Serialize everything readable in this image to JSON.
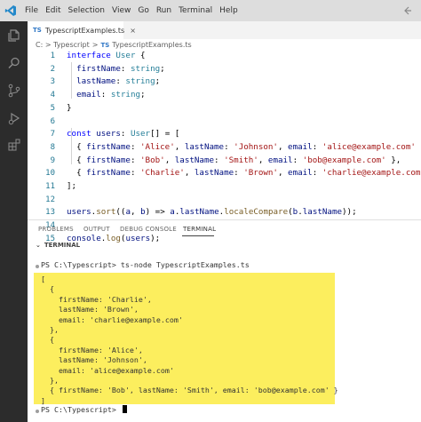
{
  "menu": [
    "File",
    "Edit",
    "Selection",
    "View",
    "Go",
    "Run",
    "Terminal",
    "Help"
  ],
  "editor": {
    "tab_badge": "TS",
    "tab_label": "TypescriptExamples.ts",
    "tab_close": "×",
    "breadcrumb": {
      "folder": "C: > Typescript",
      "sep": ">",
      "badge": "TS",
      "file": "TypescriptExamples.ts"
    },
    "line_numbers": [
      "1",
      "2",
      "3",
      "4",
      "5",
      "6",
      "7",
      "8",
      "9",
      "10",
      "11",
      "12",
      "13",
      "14",
      "15"
    ],
    "lines": [
      [
        {
          "t": "interface ",
          "c": "kw"
        },
        {
          "t": "User",
          "c": "ty"
        },
        {
          "t": " {",
          "c": "pl"
        }
      ],
      [
        {
          "t": "  firstName",
          "c": "vr"
        },
        {
          "t": ": ",
          "c": "pl"
        },
        {
          "t": "string",
          "c": "ty"
        },
        {
          "t": ";",
          "c": "pl"
        }
      ],
      [
        {
          "t": "  lastName",
          "c": "vr"
        },
        {
          "t": ": ",
          "c": "pl"
        },
        {
          "t": "string",
          "c": "ty"
        },
        {
          "t": ";",
          "c": "pl"
        }
      ],
      [
        {
          "t": "  email",
          "c": "vr"
        },
        {
          "t": ": ",
          "c": "pl"
        },
        {
          "t": "string",
          "c": "ty"
        },
        {
          "t": ";",
          "c": "pl"
        }
      ],
      [
        {
          "t": "}",
          "c": "pl"
        }
      ],
      [],
      [
        {
          "t": "const ",
          "c": "kw"
        },
        {
          "t": "users",
          "c": "vr"
        },
        {
          "t": ": ",
          "c": "pl"
        },
        {
          "t": "User",
          "c": "ty"
        },
        {
          "t": "[] = [",
          "c": "pl"
        }
      ],
      [
        {
          "t": "  { ",
          "c": "pl"
        },
        {
          "t": "firstName",
          "c": "vr"
        },
        {
          "t": ": ",
          "c": "pl"
        },
        {
          "t": "'Alice'",
          "c": "st"
        },
        {
          "t": ", ",
          "c": "pl"
        },
        {
          "t": "lastName",
          "c": "vr"
        },
        {
          "t": ": ",
          "c": "pl"
        },
        {
          "t": "'Johnson'",
          "c": "st"
        },
        {
          "t": ", ",
          "c": "pl"
        },
        {
          "t": "email",
          "c": "vr"
        },
        {
          "t": ": ",
          "c": "pl"
        },
        {
          "t": "'alice@example.com'",
          "c": "st"
        },
        {
          "t": " },",
          "c": "pl"
        }
      ],
      [
        {
          "t": "  { ",
          "c": "pl"
        },
        {
          "t": "firstName",
          "c": "vr"
        },
        {
          "t": ": ",
          "c": "pl"
        },
        {
          "t": "'Bob'",
          "c": "st"
        },
        {
          "t": ", ",
          "c": "pl"
        },
        {
          "t": "lastName",
          "c": "vr"
        },
        {
          "t": ": ",
          "c": "pl"
        },
        {
          "t": "'Smith'",
          "c": "st"
        },
        {
          "t": ", ",
          "c": "pl"
        },
        {
          "t": "email",
          "c": "vr"
        },
        {
          "t": ": ",
          "c": "pl"
        },
        {
          "t": "'bob@example.com'",
          "c": "st"
        },
        {
          "t": " },",
          "c": "pl"
        }
      ],
      [
        {
          "t": "  { ",
          "c": "pl"
        },
        {
          "t": "firstName",
          "c": "vr"
        },
        {
          "t": ": ",
          "c": "pl"
        },
        {
          "t": "'Charlie'",
          "c": "st"
        },
        {
          "t": ", ",
          "c": "pl"
        },
        {
          "t": "lastName",
          "c": "vr"
        },
        {
          "t": ": ",
          "c": "pl"
        },
        {
          "t": "'Brown'",
          "c": "st"
        },
        {
          "t": ", ",
          "c": "pl"
        },
        {
          "t": "email",
          "c": "vr"
        },
        {
          "t": ": ",
          "c": "pl"
        },
        {
          "t": "'charlie@example.com'",
          "c": "st"
        },
        {
          "t": " },",
          "c": "pl"
        }
      ],
      [
        {
          "t": "];",
          "c": "pl"
        }
      ],
      [],
      [
        {
          "t": "users",
          "c": "vr"
        },
        {
          "t": ".",
          "c": "pl"
        },
        {
          "t": "sort",
          "c": "fn"
        },
        {
          "t": "((",
          "c": "pl"
        },
        {
          "t": "a",
          "c": "vr"
        },
        {
          "t": ", ",
          "c": "pl"
        },
        {
          "t": "b",
          "c": "vr"
        },
        {
          "t": ") => ",
          "c": "pl"
        },
        {
          "t": "a",
          "c": "vr"
        },
        {
          "t": ".",
          "c": "pl"
        },
        {
          "t": "lastName",
          "c": "vr"
        },
        {
          "t": ".",
          "c": "pl"
        },
        {
          "t": "localeCompare",
          "c": "fn"
        },
        {
          "t": "(",
          "c": "pl"
        },
        {
          "t": "b",
          "c": "vr"
        },
        {
          "t": ".",
          "c": "pl"
        },
        {
          "t": "lastName",
          "c": "vr"
        },
        {
          "t": "));",
          "c": "pl"
        }
      ],
      [],
      [
        {
          "t": "console",
          "c": "vr"
        },
        {
          "t": ".",
          "c": "pl"
        },
        {
          "t": "log",
          "c": "fn"
        },
        {
          "t": "(",
          "c": "pl"
        },
        {
          "t": "users",
          "c": "vr"
        },
        {
          "t": ");",
          "c": "pl"
        }
      ]
    ]
  },
  "panel": {
    "tabs": [
      "PROBLEMS",
      "OUTPUT",
      "DEBUG CONSOLE",
      "TERMINAL"
    ],
    "active_tab": "TERMINAL",
    "section_chevron": "⌄",
    "section_title": "TERMINAL",
    "prompt": "PS C:\\Typescript> ",
    "command": "ts-node TypescriptExamples.ts",
    "output": [
      "[",
      "  {",
      "    firstName: 'Charlie',",
      "    lastName: 'Brown',",
      "    email: 'charlie@example.com'",
      "  },",
      "  {",
      "    firstName: 'Alice',",
      "    lastName: 'Johnson',",
      "    email: 'alice@example.com'",
      "  },",
      "  { firstName: 'Bob', lastName: 'Smith', email: 'bob@example.com' }",
      "]"
    ],
    "final_prompt": "PS C:\\Typescript> "
  },
  "colors": {
    "highlight": "#fcee5e",
    "activity_bar": "#2c2c2c",
    "title_bar": "#dddddd",
    "accent": "#3178c6"
  }
}
